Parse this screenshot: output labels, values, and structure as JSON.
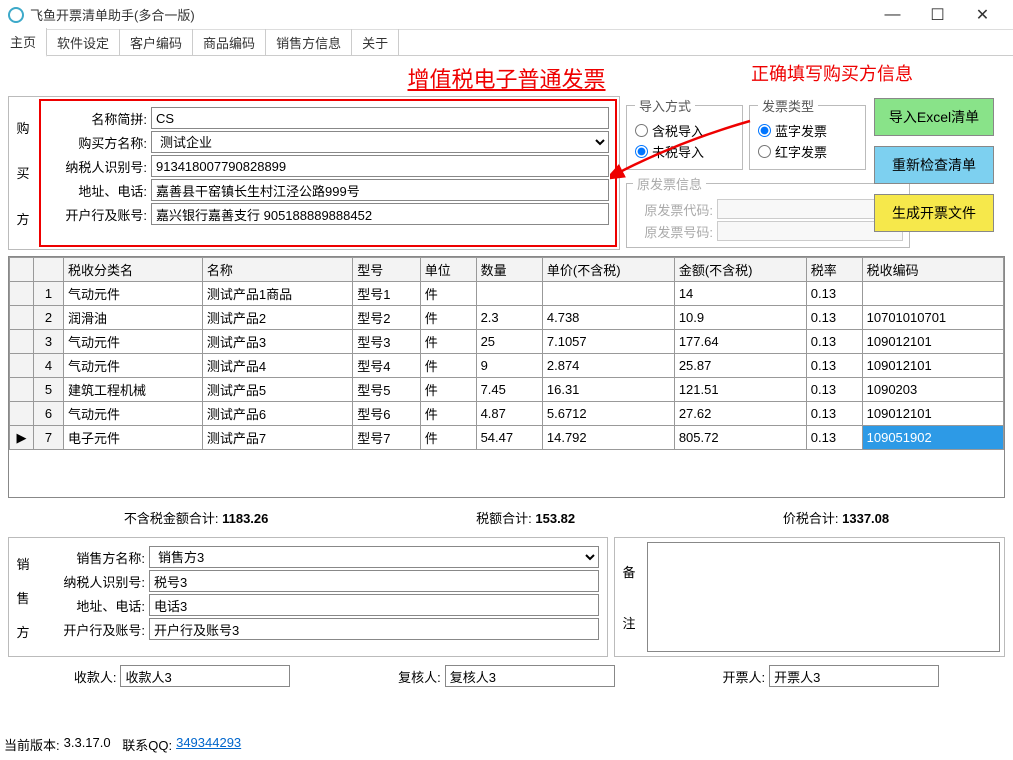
{
  "window": {
    "title": "飞鱼开票清单助手(多合一版)"
  },
  "menu": {
    "home": "主页",
    "settings": "软件设定",
    "cust": "客户编码",
    "prod": "商品编码",
    "seller": "销售方信息",
    "about": "关于"
  },
  "banner": {
    "title": "增值税电子普通发票",
    "hint": "正确填写购买方信息"
  },
  "buyer": {
    "section": {
      "c1": "购",
      "c2": "买",
      "c3": "方"
    },
    "labels": {
      "pinyin": "名称简拼:",
      "name": "购买方名称:",
      "taxid": "纳税人识别号:",
      "addrtel": "地址、电话:",
      "bank": "开户行及账号:"
    },
    "pinyin": "CS",
    "name": "测试企业",
    "taxid": "913418007790828899",
    "addrtel": "嘉善县干窑镇长生村江泾公路999号",
    "bank": "嘉兴银行嘉善支行 905188889888452"
  },
  "import": {
    "legend": "导入方式",
    "opt1": "含税导入",
    "opt2": "未税导入"
  },
  "invtype": {
    "legend": "发票类型",
    "opt1": "蓝字发票",
    "opt2": "红字发票"
  },
  "orig": {
    "legend": "原发票信息",
    "codeLabel": "原发票代码:",
    "numLabel": "原发票号码:",
    "code": "",
    "num": ""
  },
  "buttons": {
    "import": "导入Excel清单",
    "recheck": "重新检查清单",
    "generate": "生成开票文件"
  },
  "table": {
    "headers": {
      "taxcat": "税收分类名",
      "name": "名称",
      "model": "型号",
      "unit": "单位",
      "qty": "数量",
      "price": "单价(不含税)",
      "amount": "金额(不含税)",
      "rate": "税率",
      "taxcode": "税收编码"
    },
    "rows": [
      {
        "idx": "1",
        "taxcat": "气动元件",
        "name": "测试产品1商品",
        "model": "型号1",
        "unit": "件",
        "qty": "",
        "price": "",
        "amount": "14",
        "rate": "0.13",
        "taxcode": ""
      },
      {
        "idx": "2",
        "taxcat": "润滑油",
        "name": "测试产品2",
        "model": "型号2",
        "unit": "件",
        "qty": "2.3",
        "price": "4.738",
        "amount": "10.9",
        "rate": "0.13",
        "taxcode": "10701010701"
      },
      {
        "idx": "3",
        "taxcat": "气动元件",
        "name": "测试产品3",
        "model": "型号3",
        "unit": "件",
        "qty": "25",
        "price": "7.1057",
        "amount": "177.64",
        "rate": "0.13",
        "taxcode": "109012101"
      },
      {
        "idx": "4",
        "taxcat": "气动元件",
        "name": "测试产品4",
        "model": "型号4",
        "unit": "件",
        "qty": "9",
        "price": "2.874",
        "amount": "25.87",
        "rate": "0.13",
        "taxcode": "109012101"
      },
      {
        "idx": "5",
        "taxcat": "建筑工程机械",
        "name": "测试产品5",
        "model": "型号5",
        "unit": "件",
        "qty": "7.45",
        "price": "16.31",
        "amount": "121.51",
        "rate": "0.13",
        "taxcode": "1090203"
      },
      {
        "idx": "6",
        "taxcat": "气动元件",
        "name": "测试产品6",
        "model": "型号6",
        "unit": "件",
        "qty": "4.87",
        "price": "5.6712",
        "amount": "27.62",
        "rate": "0.13",
        "taxcode": "109012101"
      },
      {
        "idx": "7",
        "taxcat": "电子元件",
        "name": "测试产品7",
        "model": "型号7",
        "unit": "件",
        "qty": "54.47",
        "price": "14.792",
        "amount": "805.72",
        "rate": "0.13",
        "taxcode": "109051902"
      }
    ]
  },
  "totals": {
    "subtotal_label": "不含税金额合计:",
    "subtotal": "1183.26",
    "tax_label": "税额合计:",
    "tax": "153.82",
    "total_label": "价税合计:",
    "total": "1337.08"
  },
  "seller": {
    "section": {
      "c1": "销",
      "c2": "售",
      "c3": "方"
    },
    "labels": {
      "name": "销售方名称:",
      "taxid": "纳税人识别号:",
      "addrtel": "地址、电话:",
      "bank": "开户行及账号:"
    },
    "name": "销售方3",
    "taxid": "税号3",
    "addrtel": "电话3",
    "bank": "开户行及账号3"
  },
  "notes": {
    "c1": "备",
    "c2": "注"
  },
  "people": {
    "payee_label": "收款人:",
    "payee": "收款人3",
    "reviewer_label": "复核人:",
    "reviewer": "复核人3",
    "issuer_label": "开票人:",
    "issuer": "开票人3"
  },
  "status": {
    "version_label": "当前版本:",
    "version": "3.3.17.0",
    "qq_label": "联系QQ:",
    "qq": "349344293"
  }
}
